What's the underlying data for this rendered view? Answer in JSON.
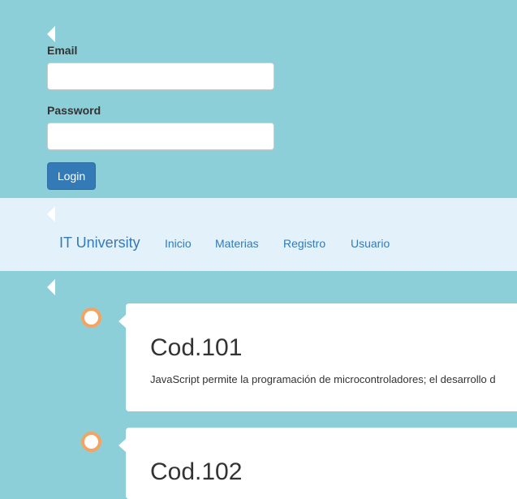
{
  "login": {
    "email_label": "Email",
    "email_value": "",
    "password_label": "Password",
    "password_value": "",
    "button_label": "Login"
  },
  "navbar": {
    "brand": "IT University",
    "links": [
      "Inicio",
      "Materias",
      "Registro",
      "Usuario"
    ]
  },
  "timeline": {
    "items": [
      {
        "title": "Cod.101",
        "text": "JavaScript permite la programación de microcontroladores; el desarrollo d"
      },
      {
        "title": "Cod.102",
        "text": ""
      }
    ]
  },
  "colors": {
    "background": "#8ccfd9",
    "navbar": "#e3f1fb",
    "primary": "#337ab7",
    "dot_border": "#f4a460"
  },
  "icons": {
    "collapse": "caret-left-icon",
    "timeline_marker": "circle-marker-icon"
  }
}
